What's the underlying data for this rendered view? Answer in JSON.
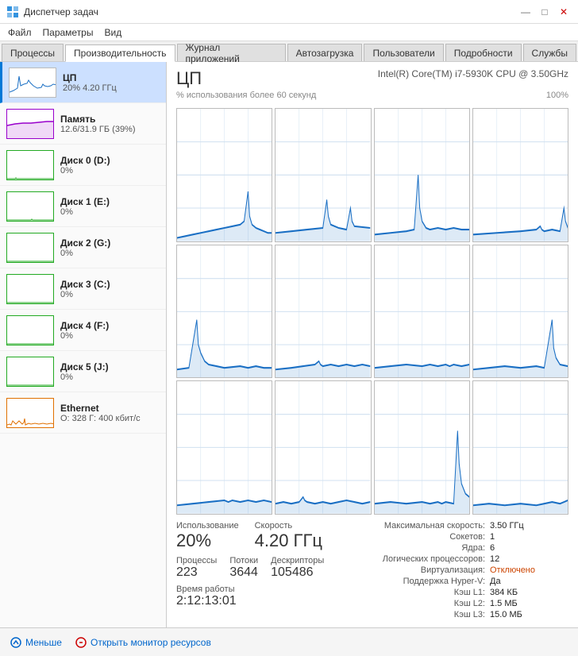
{
  "window": {
    "title": "Диспетчер задач",
    "controls": [
      "—",
      "□",
      "✕"
    ]
  },
  "menu": {
    "items": [
      "Файл",
      "Параметры",
      "Вид"
    ]
  },
  "tabs": {
    "items": [
      "Процессы",
      "Производительность",
      "Журнал приложений",
      "Автозагрузка",
      "Пользователи",
      "Подробности",
      "Службы"
    ],
    "active": 1
  },
  "sidebar": {
    "items": [
      {
        "id": "cpu",
        "title": "ЦП",
        "subtitle": "20% 4.20 ГГц",
        "active": true
      },
      {
        "id": "memory",
        "title": "Память",
        "subtitle": "12.6/31.9 ГБ (39%)"
      },
      {
        "id": "disk0",
        "title": "Диск 0 (D:)",
        "subtitle": "0%"
      },
      {
        "id": "disk1",
        "title": "Диск 1 (E:)",
        "subtitle": "0%"
      },
      {
        "id": "disk2",
        "title": "Диск 2 (G:)",
        "subtitle": "0%"
      },
      {
        "id": "disk3",
        "title": "Диск 3 (C:)",
        "subtitle": "0%"
      },
      {
        "id": "disk4",
        "title": "Диск 4 (F:)",
        "subtitle": "0%"
      },
      {
        "id": "disk5",
        "title": "Диск 5 (J:)",
        "subtitle": "0%"
      },
      {
        "id": "ethernet",
        "title": "Ethernet",
        "subtitle": "О: 328 Г: 400 кбит/с"
      }
    ]
  },
  "panel": {
    "title": "ЦП",
    "subtitle": "Intel(R) Core(TM) i7-5930K CPU @ 3.50GHz",
    "description": "% использования более 60 секунд",
    "usage_pct": "100%",
    "usage": {
      "label": "Использование",
      "value": "20%"
    },
    "speed": {
      "label": "Скорость",
      "value": "4.20 ГГц"
    },
    "processes": {
      "label": "Процессы",
      "value": "223"
    },
    "threads": {
      "label": "Потоки",
      "value": "3644"
    },
    "descriptors": {
      "label": "Дескрипторы",
      "value": "105486"
    },
    "uptime": {
      "label": "Время работы",
      "value": "2:12:13:01"
    }
  },
  "info": {
    "max_speed": {
      "key": "Максимальная скорость:",
      "value": "3.50 ГГц"
    },
    "sockets": {
      "key": "Сокетов:",
      "value": "1"
    },
    "cores": {
      "key": "Ядра:",
      "value": "6"
    },
    "logical": {
      "key": "Логических процессоров:",
      "value": "12"
    },
    "virtualization": {
      "key": "Виртуализация:",
      "value": "Отключено",
      "highlight": true
    },
    "hyper_v": {
      "key": "Поддержка Hyper-V:",
      "value": "Да"
    },
    "l1_cache": {
      "key": "Кэш L1:",
      "value": "384 КБ"
    },
    "l2_cache": {
      "key": "Кэш L2:",
      "value": "1.5 МБ"
    },
    "l3_cache": {
      "key": "Кэш L3:",
      "value": "15.0 МБ"
    }
  },
  "bottom": {
    "less_btn": "Меньше",
    "monitor_btn": "Открыть монитор ресурсов"
  }
}
